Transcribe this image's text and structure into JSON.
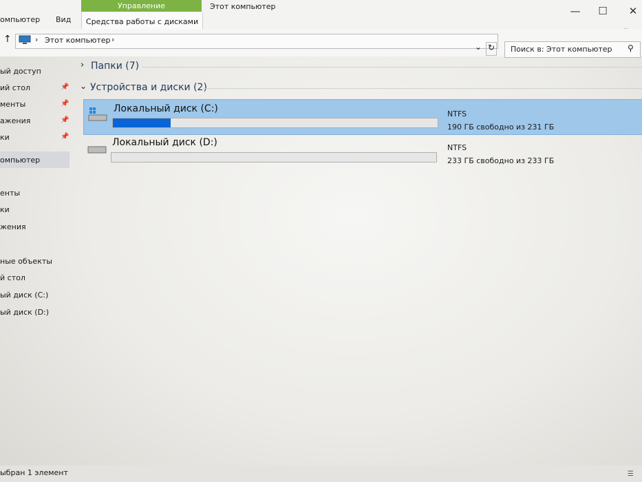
{
  "ribbon": {
    "tab_computer": "омпьютер",
    "tab_view": "Вид",
    "context_header": "Управление",
    "context_tab": "Средства работы с дисками",
    "window_title": "Этот компьютер",
    "colors": {
      "context_header": "#7cb342"
    }
  },
  "address": {
    "breadcrumb": "Этот компьютер",
    "search_placeholder": "Поиск в: Этот компьютер",
    "icons": [
      "up-arrow-icon",
      "computer-icon",
      "chevron-right-icon",
      "dropdown-icon",
      "refresh-icon",
      "search-icon"
    ]
  },
  "sidebar": {
    "items": [
      {
        "label": "ый доступ",
        "pinned": false
      },
      {
        "label": "ий стол",
        "pinned": true
      },
      {
        "label": "менты",
        "pinned": true
      },
      {
        "label": "ажения",
        "pinned": true
      },
      {
        "label": "ки",
        "pinned": true
      },
      {
        "label": "омпьютер",
        "selected": true
      },
      {
        "label": "енты"
      },
      {
        "label": "ки"
      },
      {
        "label": "жения"
      },
      {
        "label": "ные объекты"
      },
      {
        "label": "й стол"
      },
      {
        "label": "ый диск (C:)"
      },
      {
        "label": "ый диск (D:)"
      }
    ]
  },
  "content": {
    "folders_group": "Папки (7)",
    "devices_group": "Устройства и диски (2)",
    "drives": [
      {
        "name": "Локальный диск (C:)",
        "fs": "NTFS",
        "free_text": "190 ГБ свободно из 231 ГБ",
        "used_fraction": 0.177,
        "selected": true
      },
      {
        "name": "Локальный диск (D:)",
        "fs": "NTFS",
        "free_text": "233 ГБ свободно из 233 ГБ",
        "used_fraction": 0.0,
        "selected": false
      }
    ]
  },
  "status": {
    "text": "ыбран 1 элемент"
  }
}
